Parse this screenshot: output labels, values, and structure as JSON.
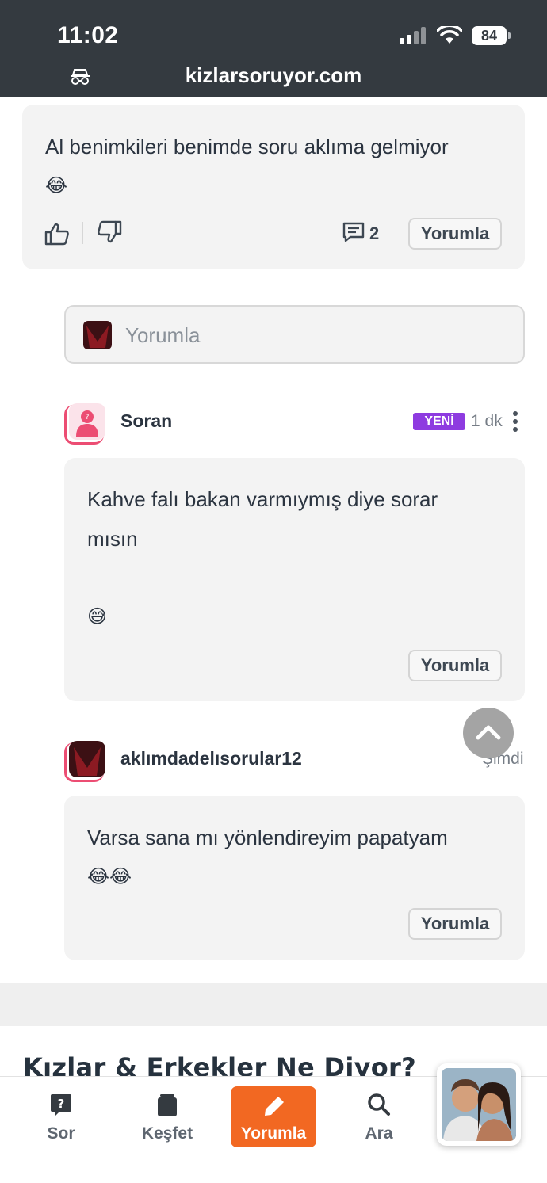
{
  "status_bar": {
    "time": "11:02",
    "battery": "84"
  },
  "browser": {
    "url": "kizlarsoruyor.com"
  },
  "first_card": {
    "text": "Al benimkileri benimde soru aklıma gelmiyor",
    "emoji": "😂",
    "comment_count": "2",
    "reply_button": "Yorumla"
  },
  "comment_input": {
    "placeholder": "Yorumla"
  },
  "replies": [
    {
      "username": "Soran",
      "badge": "YENİ",
      "time": "1 dk",
      "text_line1": "Kahve falı bakan varmıymış diye sorar",
      "text_line2": "mısın",
      "emoji": "😅",
      "reply_button": "Yorumla"
    },
    {
      "username": "aklımdadelısorular12",
      "time": "Şimdi",
      "text": "Varsa sana mı yönlendireyim papatyam",
      "emoji": "😂😂",
      "reply_button": "Yorumla"
    }
  ],
  "section": {
    "title": "Kızlar & Erkekler Ne Diyor?"
  },
  "bottom_nav": [
    {
      "label": "Sor",
      "icon": "question-bubble-icon"
    },
    {
      "label": "Keşfet",
      "icon": "stack-icon"
    },
    {
      "label": "Yorumla",
      "icon": "pencil-icon"
    },
    {
      "label": "Ara",
      "icon": "search-icon"
    }
  ],
  "colors": {
    "accent": "#f26822",
    "badge_new": "#8e3be0",
    "header_bg": "#343a40",
    "card_bg": "#f3f3f3"
  }
}
